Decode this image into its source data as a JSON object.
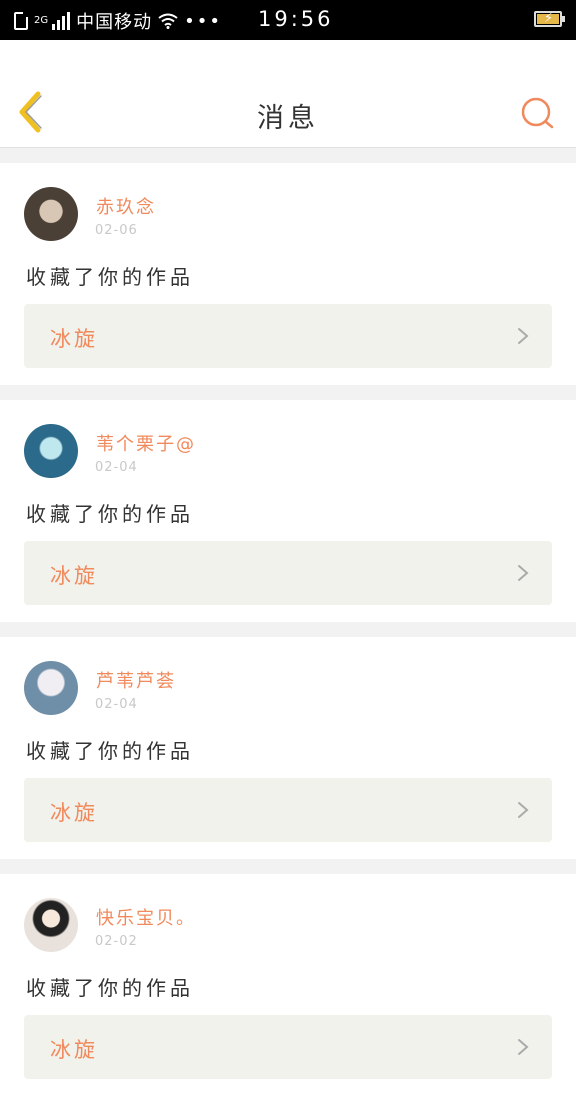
{
  "status_bar": {
    "network": "2G",
    "carrier": "中国移动",
    "more": "•••",
    "time": "19:56"
  },
  "header": {
    "title": "消息"
  },
  "messages": [
    {
      "username": "赤玖念",
      "date": "02-06",
      "action": "收藏了你的作品",
      "work_title": "冰旋",
      "avatar_color": "#4a4036"
    },
    {
      "username": "苇个栗子@",
      "date": "02-04",
      "action": "收藏了你的作品",
      "work_title": "冰旋",
      "avatar_color": "#2b6a8a"
    },
    {
      "username": "芦苇芦荟",
      "date": "02-04",
      "action": "收藏了你的作品",
      "work_title": "冰旋",
      "avatar_color": "#6f8fa8"
    },
    {
      "username": "快乐宝贝。",
      "date": "02-02",
      "action": "收藏了你的作品",
      "work_title": "冰旋",
      "avatar_color": "#e9e2dc"
    }
  ],
  "colors": {
    "accent": "#f08a5d",
    "back_icon": "#f0c020",
    "card_bg": "#f2f2ec"
  }
}
